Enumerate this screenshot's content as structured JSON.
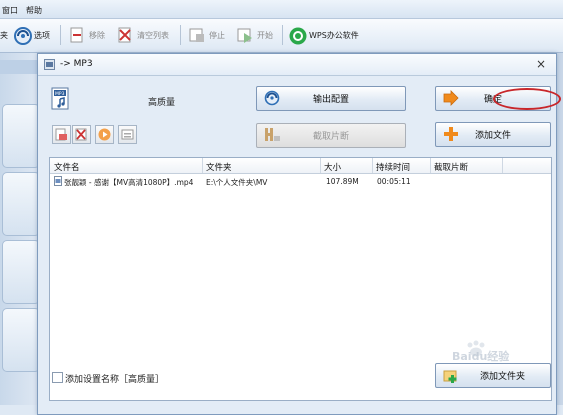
{
  "menubar": {
    "items": [
      "窗口",
      "帮助"
    ]
  },
  "toolbar": {
    "items": [
      {
        "label": "夹",
        "icon": "folder-icon"
      },
      {
        "label": "选项",
        "icon": "options-icon"
      },
      {
        "label": "移除",
        "icon": "remove-icon",
        "disabled": true
      },
      {
        "label": "清空列表",
        "icon": "clear-list-icon",
        "disabled": true
      },
      {
        "label": "停止",
        "icon": "stop-icon",
        "disabled": true
      },
      {
        "label": "开始",
        "icon": "start-icon",
        "disabled": true
      },
      {
        "label": "WPS办公软件",
        "icon": "wps-icon"
      }
    ]
  },
  "dialog": {
    "title": "-> MP3",
    "close_label": "×",
    "preset_name": "高质量",
    "output_config_label": "输出配置",
    "confirm_label": "确定",
    "clip_label": "截取片断",
    "add_file_label": "添加文件",
    "add_folder_label": "添加文件夹",
    "save_preset_label": "添加设置名称［高质量］",
    "table": {
      "columns": [
        "文件名",
        "文件夹",
        "大小",
        "持续时间",
        "截取片断"
      ],
      "rows": [
        {
          "name": "张靓颖 - 感谢【MV高清1080P】.mp4",
          "folder": "E:\\个人文件夹\\MV",
          "size": "107.89M",
          "duration": "00:05:11",
          "clip": ""
        }
      ]
    }
  },
  "colors": {
    "accent": "#2f6fb5",
    "highlight_oval": "#c8262a",
    "orange": "#f08a1c",
    "wps_green": "#2aa84a"
  },
  "watermark": "Baidu经验"
}
